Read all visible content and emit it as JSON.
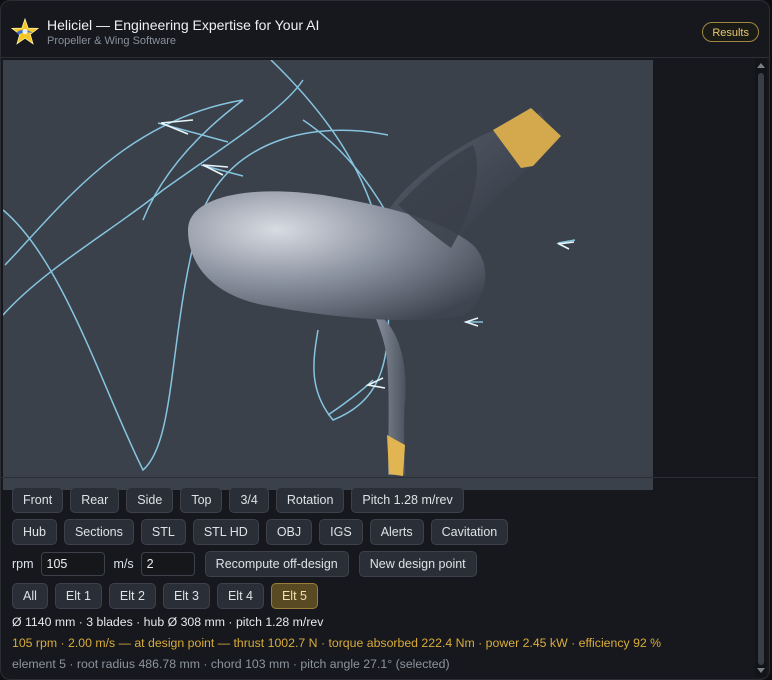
{
  "app": {
    "title": "Heliciel — Engineering Expertise for Your AI",
    "subtitle": "Propeller & Wing Software",
    "results_label": "Results"
  },
  "view_buttons": [
    {
      "label": "Front"
    },
    {
      "label": "Rear"
    },
    {
      "label": "Side"
    },
    {
      "label": "Top"
    },
    {
      "label": "3/4"
    },
    {
      "label": "Rotation"
    },
    {
      "label": "Pitch 1.28 m/rev"
    }
  ],
  "export_buttons": [
    {
      "label": "Hub"
    },
    {
      "label": "Sections"
    },
    {
      "label": "STL"
    },
    {
      "label": "STL HD"
    },
    {
      "label": "OBJ"
    },
    {
      "label": "IGS"
    },
    {
      "label": "Alerts"
    },
    {
      "label": "Cavitation"
    }
  ],
  "operating": {
    "rpm_label": "rpm",
    "rpm_value": "105",
    "speed_label": "m/s",
    "speed_value": "2",
    "recompute_label": "Recompute off-design",
    "new_point_label": "New design point"
  },
  "elements": {
    "items": [
      "All",
      "Elt 1",
      "Elt 2",
      "Elt 3",
      "Elt 4",
      "Elt 5"
    ],
    "selected": "Elt 5"
  },
  "info": {
    "geometry": "Ø 1140 mm · 3 blades · hub Ø 308 mm · pitch 1.28 m/rev",
    "performance": "105 rpm · 2.00 m/s — at design point — thrust 1002.7 N · torque absorbed 222.4 Nm · power 2.45 kW · efficiency 92 %",
    "element": "element 5 · root radius 486.78 mm · chord 103 mm · pitch angle 27.1° (selected)"
  },
  "colors": {
    "accent": "#e8c76e",
    "performance_text": "#d9ac3a",
    "viewport_bg": "#3a414b",
    "streamline": "#8fd3f0",
    "blade_tip": "#d4a94e"
  },
  "icons": {
    "logo": "star-logo-icon"
  }
}
